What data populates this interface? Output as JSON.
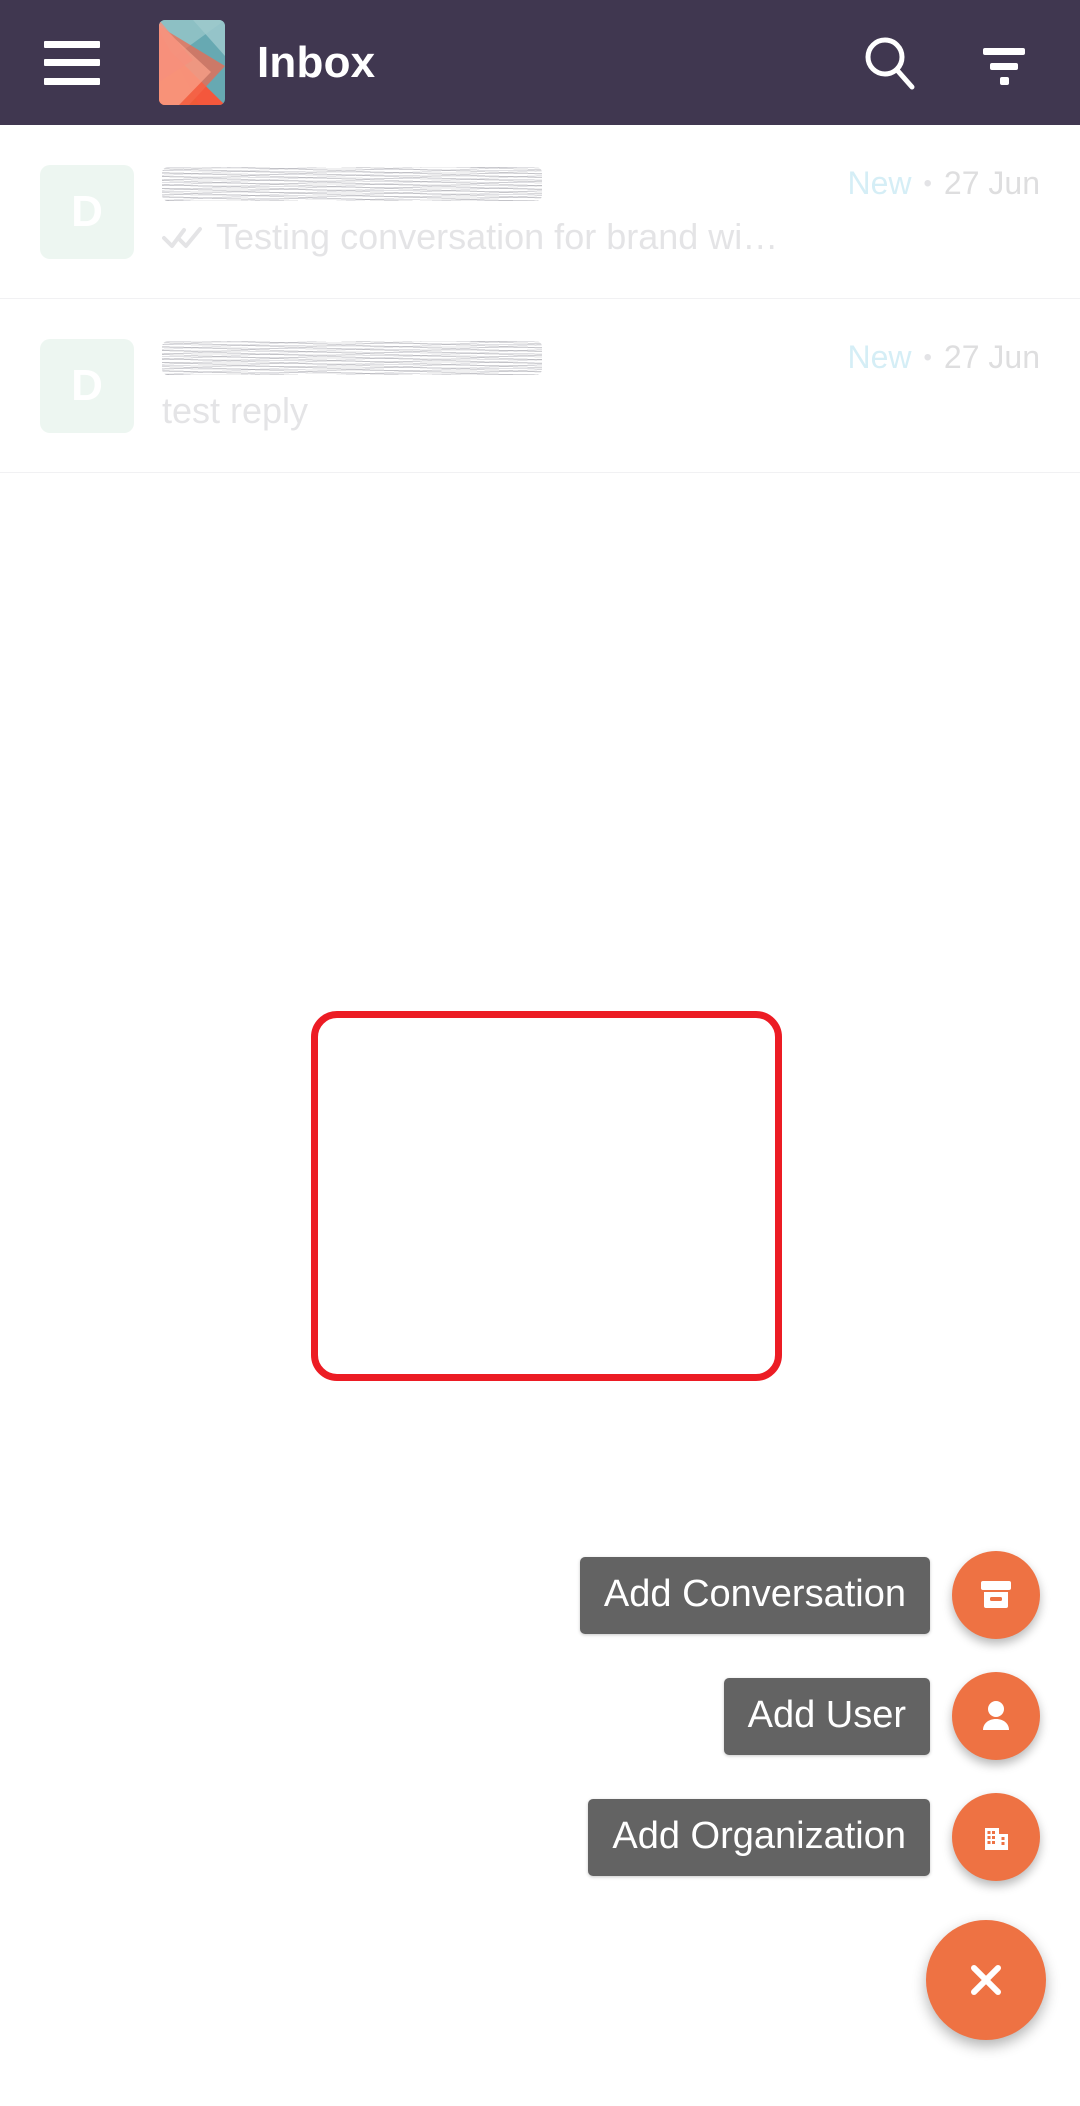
{
  "appbar": {
    "menu_icon": "hamburger-icon",
    "logo_icon": "kayako-logo",
    "title": "Inbox",
    "search_icon": "search-icon",
    "filter_icon": "filter-icon",
    "background": "#403750"
  },
  "conversations": [
    {
      "avatar_letter": "D",
      "sender_redacted": true,
      "redaction_width": 380,
      "status": "New",
      "separator": "•",
      "date": "27 Jun",
      "preview": "Testing conversation for brand wi…",
      "has_read_receipt": true
    },
    {
      "avatar_letter": "D",
      "sender_redacted": true,
      "redaction_width": 380,
      "status": "New",
      "separator": "•",
      "date": "27 Jun",
      "preview": "test reply",
      "has_read_receipt": false
    }
  ],
  "speed_dial": {
    "accent_color": "#ee7243",
    "label_background": "#636363",
    "items": [
      {
        "label": "Add Conversation",
        "icon": "archive-box-icon"
      },
      {
        "label": "Add User",
        "icon": "person-icon"
      },
      {
        "label": "Add Organization",
        "icon": "building-icon"
      }
    ],
    "main_action": {
      "icon": "close-icon",
      "label": "Close menu"
    }
  },
  "highlight": {
    "color": "#ec1c24",
    "purpose": "annotation-box-around-speed-dial-items"
  }
}
